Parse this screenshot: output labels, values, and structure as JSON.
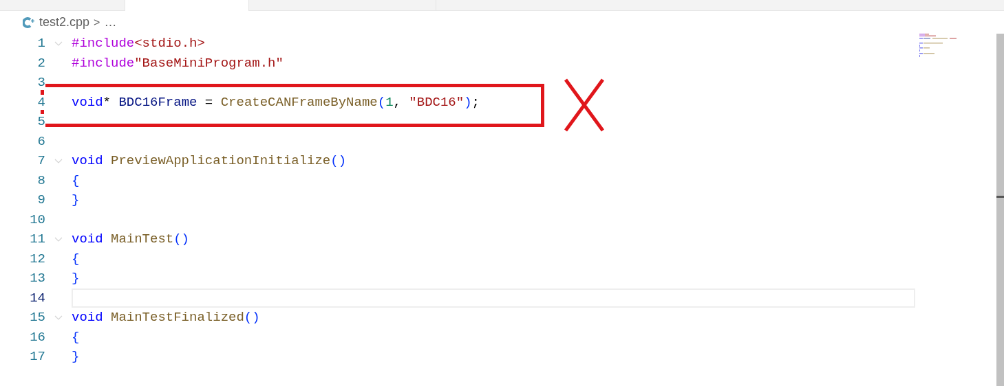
{
  "tabs": [
    {
      "selected": false
    },
    {
      "selected": true
    },
    {
      "selected": false
    }
  ],
  "breadcrumb": {
    "file": "test2.cpp",
    "separator": ">",
    "rest": "…"
  },
  "editor": {
    "lines": [
      {
        "number": "1",
        "foldable": true,
        "current": false,
        "tokens": [
          {
            "text": "#include",
            "kind": "directive"
          },
          {
            "text": "<stdio.h>",
            "kind": "string"
          }
        ]
      },
      {
        "number": "2",
        "foldable": false,
        "current": false,
        "tokens": [
          {
            "text": "#include",
            "kind": "directive"
          },
          {
            "text": "\"BaseMiniProgram.h\"",
            "kind": "string"
          }
        ]
      },
      {
        "number": "3",
        "foldable": false,
        "current": false
      },
      {
        "number": "4",
        "foldable": false,
        "current": false,
        "tokens": [
          {
            "text": "void",
            "kind": "keyword"
          },
          {
            "text": "* ",
            "kind": "plain"
          },
          {
            "text": "BDC16Frame",
            "kind": "variable"
          },
          {
            "text": " = ",
            "kind": "plain"
          },
          {
            "text": "CreateCANFrameByName",
            "kind": "function"
          },
          {
            "text": "(",
            "kind": "bracket"
          },
          {
            "text": "1",
            "kind": "number"
          },
          {
            "text": ", ",
            "kind": "plain"
          },
          {
            "text": "\"BDC16\"",
            "kind": "string"
          },
          {
            "text": ")",
            "kind": "bracket"
          },
          {
            "text": ";",
            "kind": "plain"
          }
        ]
      },
      {
        "number": "5",
        "foldable": false,
        "current": false
      },
      {
        "number": "6",
        "foldable": false,
        "current": false
      },
      {
        "number": "7",
        "foldable": true,
        "current": false,
        "tokens": [
          {
            "text": "void",
            "kind": "keyword"
          },
          {
            "text": "PreviewApplicationInitialize",
            "kind": "function"
          },
          {
            "text": "()",
            "kind": "bracket"
          }
        ]
      },
      {
        "number": "8",
        "foldable": false,
        "current": false,
        "tokens": [
          {
            "text": "{",
            "kind": "bracket"
          }
        ]
      },
      {
        "number": "9",
        "foldable": false,
        "current": false,
        "tokens": [
          {
            "text": "}",
            "kind": "bracket"
          }
        ]
      },
      {
        "number": "10",
        "foldable": false,
        "current": false
      },
      {
        "number": "11",
        "foldable": true,
        "current": false,
        "tokens": [
          {
            "text": "void",
            "kind": "keyword"
          },
          {
            "text": "MainTest",
            "kind": "function"
          },
          {
            "text": "()",
            "kind": "bracket"
          }
        ]
      },
      {
        "number": "12",
        "foldable": false,
        "current": false,
        "tokens": [
          {
            "text": "{",
            "kind": "bracket"
          }
        ]
      },
      {
        "number": "13",
        "foldable": false,
        "current": false,
        "tokens": [
          {
            "text": "}",
            "kind": "bracket"
          }
        ]
      },
      {
        "number": "14",
        "foldable": false,
        "current": true
      },
      {
        "number": "15",
        "foldable": true,
        "current": false,
        "tokens": [
          {
            "text": "void",
            "kind": "keyword"
          },
          {
            "text": "MainTestFinalized",
            "kind": "function"
          },
          {
            "text": "()",
            "kind": "bracket"
          }
        ]
      },
      {
        "number": "16",
        "foldable": false,
        "current": false,
        "tokens": [
          {
            "text": "{",
            "kind": "bracket"
          }
        ]
      },
      {
        "number": "17",
        "foldable": false,
        "current": false,
        "tokens": [
          {
            "text": "}",
            "kind": "bracket"
          }
        ]
      }
    ]
  }
}
